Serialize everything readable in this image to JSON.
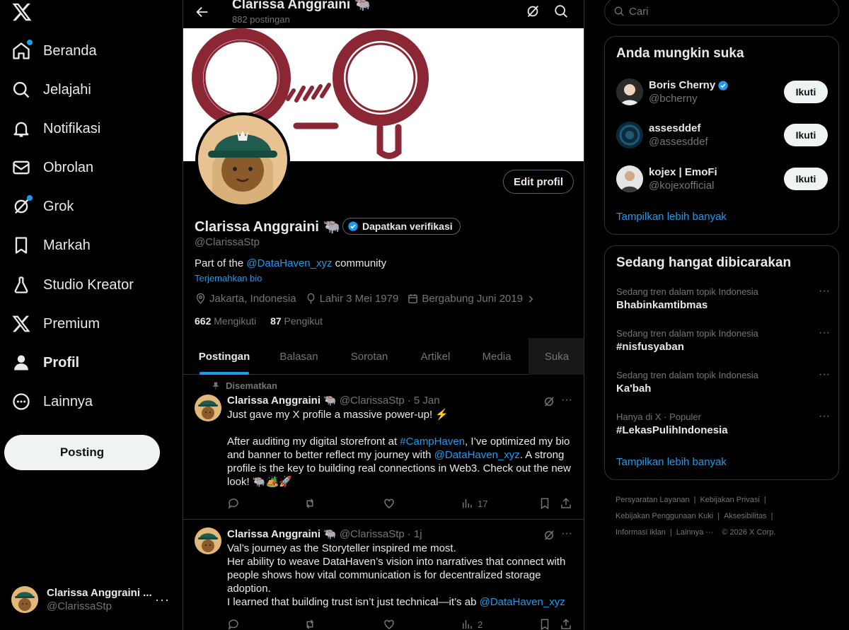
{
  "nav": {
    "items": [
      {
        "label": "Beranda",
        "icon": "home-icon",
        "badge": true
      },
      {
        "label": "Jelajahi",
        "icon": "search-icon",
        "badge": false
      },
      {
        "label": "Notifikasi",
        "icon": "bell-icon",
        "badge": false
      },
      {
        "label": "Obrolan",
        "icon": "mail-icon",
        "badge": false
      },
      {
        "label": "Grok",
        "icon": "grok-icon",
        "badge": true
      },
      {
        "label": "Markah",
        "icon": "bookmark-icon",
        "badge": false
      },
      {
        "label": "Studio Kreator",
        "icon": "flask-icon",
        "badge": false
      },
      {
        "label": "Premium",
        "icon": "x-icon",
        "badge": false
      },
      {
        "label": "Profil",
        "icon": "person-icon",
        "badge": false
      },
      {
        "label": "Lainnya",
        "icon": "more-circle-icon",
        "badge": false
      }
    ],
    "post_label": "Posting",
    "account": {
      "name": "Clarissa Anggraini ...",
      "handle": "@ClarissaStp",
      "more": "···"
    }
  },
  "header": {
    "title": "Clarissa Anggraini 🐃",
    "subtitle": "882 postingan"
  },
  "profile": {
    "name": "Clarissa Anggraini 🐃",
    "verify_label": "Dapatkan verifikasi",
    "handle": "@ClarissaStp",
    "bio_prefix": "Part of the ",
    "bio_mention": "@DataHaven_xyz",
    "bio_suffix": " community",
    "translate": "Terjemahkan bio",
    "location": "Jakarta, Indonesia",
    "birth": "Lahir 3 Mei 1979",
    "joined": "Bergabung Juni 2019",
    "following_count": "662",
    "following_label": "Mengikuti",
    "followers_count": "87",
    "followers_label": "Pengikut",
    "edit_label": "Edit profil"
  },
  "tabs": [
    "Postingan",
    "Balasan",
    "Sorotan",
    "Artikel",
    "Media",
    "Suka"
  ],
  "posts": [
    {
      "pinned": "Disematkan",
      "name": "Clarissa Anggraini 🐃",
      "handle": "@ClarissaStp",
      "time": "· 5 Jan",
      "lines": [
        "Just gave my X profile a massive power-up! ⚡",
        "",
        "After auditing my digital storefront at #CampHaven, I’ve optimized my bio",
        "and banner to better reflect my journey with @DataHaven_xyz. A strong",
        "profile is the key to building real connections in Web3. Check out the new",
        "look! 🐃🏕️🚀"
      ],
      "views": "17"
    },
    {
      "pinned": "",
      "name": "Clarissa Anggraini 🐃",
      "handle": "@ClarissaStp",
      "time": "· 1j",
      "lines": [
        "Val’s journey as the Storyteller inspired me most.",
        "Her ability to weave DataHaven’s vision into narratives that connect with",
        "people shows how vital communication is for decentralized storage",
        "adoption.",
        "I learned that building trust isn’t just technical—it’s ab @DataHaven_xyz"
      ],
      "views": "2"
    }
  ],
  "search": {
    "placeholder": "Cari"
  },
  "who_to_follow": {
    "title": "Anda mungkin suka",
    "users": [
      {
        "name": "Boris Cherny",
        "handle": "@bcherny",
        "verified": true,
        "button": "Ikuti"
      },
      {
        "name": "assesddef",
        "handle": "@assesddef",
        "verified": false,
        "button": "Ikuti"
      },
      {
        "name": "kojex | EmoFi",
        "handle": "@kojexofficial",
        "verified": false,
        "button": "Ikuti"
      }
    ],
    "show_more": "Tampilkan lebih banyak"
  },
  "trends": {
    "title": "Sedang hangat dibicarakan",
    "items": [
      {
        "context": "Sedang tren dalam topik Indonesia",
        "topic": "Bhabinkamtibmas"
      },
      {
        "context": "Sedang tren dalam topik Indonesia",
        "topic": "#nisfusyaban"
      },
      {
        "context": "Sedang tren dalam topik Indonesia",
        "topic": "Ka'bah"
      },
      {
        "context": "Hanya di X · Populer",
        "topic": "#LekasPulihIndonesia"
      }
    ],
    "show_more": "Tampilkan lebih banyak"
  },
  "footer": {
    "links": [
      "Persyaratan Layanan",
      "Kebijakan Privasi",
      "Kebijakan Penggunaan Kuki",
      "Aksesibilitas",
      "Informasi iklan",
      "Lainnya ···"
    ],
    "copyright": "© 2026 X Corp."
  },
  "colors": {
    "accent": "#1d9bf0",
    "background": "#000000",
    "text": "#e7e9ea",
    "muted": "#71767b",
    "border": "#2f3336",
    "banner_art": "#8b2635"
  }
}
